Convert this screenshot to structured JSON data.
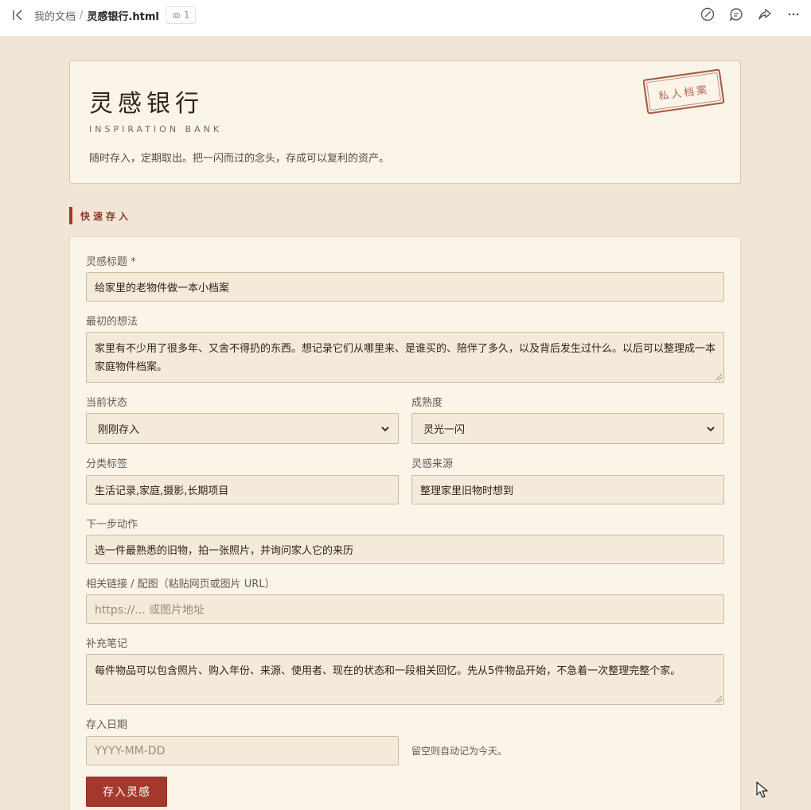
{
  "topbar": {
    "breadcrumb_root": "我的文档",
    "breadcrumb_sep": "/",
    "file_name": "灵感银行.html",
    "comment_count": "1",
    "icons": [
      "sidebar-collapse-icon",
      "link-icon",
      "edit-icon",
      "comment-icon",
      "share-icon",
      "more-icon"
    ]
  },
  "hero": {
    "title": "灵感银行",
    "subtitle": "INSPIRATION BANK",
    "description": "随时存入，定期取出。把一闪而过的念头，存成可以复利的资产。",
    "stamp": "私人档案"
  },
  "section": {
    "title": "快速存入"
  },
  "form": {
    "title_label": "灵感标题 *",
    "title_value": "给家里的老物件做一本小档案",
    "idea_label": "最初的想法",
    "idea_value": "家里有不少用了很多年、又舍不得扔的东西。想记录它们从哪里来、是谁买的、陪伴了多久，以及背后发生过什么。以后可以整理成一本家庭物件档案。",
    "status_label": "当前状态",
    "status_value": "刚刚存入",
    "maturity_label": "成熟度",
    "maturity_value": "灵光一闪",
    "tags_label": "分类标签",
    "tags_value": "生活记录,家庭,摄影,长期项目",
    "source_label": "灵感来源",
    "source_value": "整理家里旧物时想到",
    "next_label": "下一步动作",
    "next_value": "选一件最熟悉的旧物，拍一张照片，并询问家人它的来历",
    "link_label": "相关链接 / 配图（粘贴网页或图片 URL）",
    "link_placeholder": "https://...  或图片地址",
    "notes_label": "补充笔记",
    "notes_value": "每件物品可以包含照片、购入年份、来源、使用者、现在的状态和一段相关回忆。先从5件物品开始，不急着一次整理完整个家。",
    "date_label": "存入日期",
    "date_placeholder": "YYYY-MM-DD",
    "date_hint": "留空则自动记为今天。",
    "submit_label": "存入灵感"
  },
  "colors": {
    "background": "#f1e6d6",
    "card": "#faf4e9",
    "accent": "#a3382b",
    "field": "#f4ead9"
  }
}
